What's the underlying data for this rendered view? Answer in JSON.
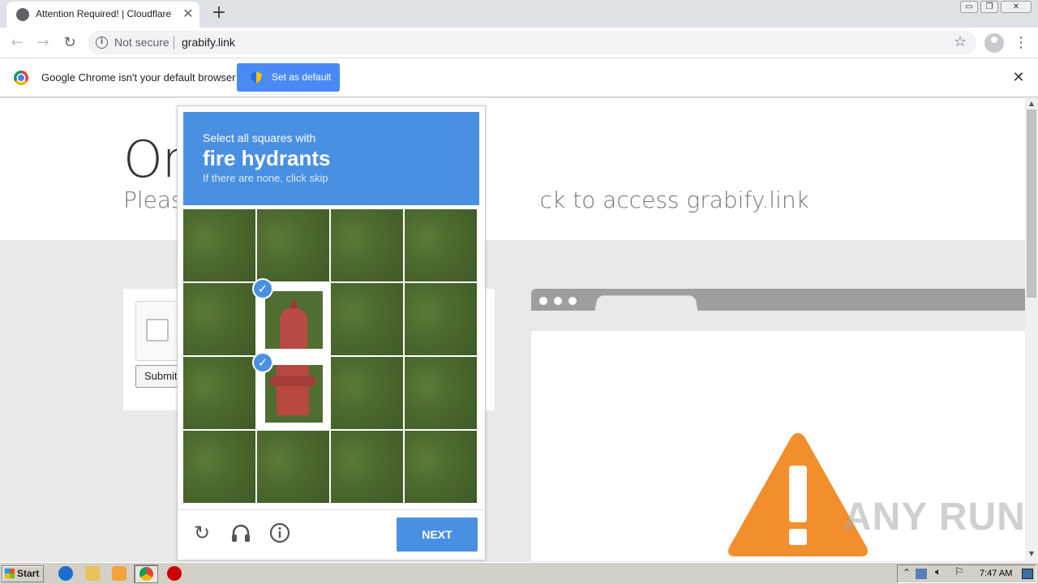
{
  "browser": {
    "tab_title": "Attention Required! | Cloudflare",
    "tab_close": "✕",
    "new_tab": "+",
    "security_label": "Not secure",
    "url": "grabify.link",
    "info_glyph": "i",
    "star_glyph": "☆",
    "menu_glyph": "⋮",
    "back_glyph": "←",
    "forward_glyph": "→",
    "reload_glyph": "↻",
    "window_buttons": [
      "▭",
      "❐",
      "✕"
    ]
  },
  "infobar": {
    "message": "Google Chrome isn't your default browser",
    "set_default_label": "Set as default",
    "close_glyph": "✕"
  },
  "page": {
    "heading_visible": "On",
    "subheading_left": "Pleas",
    "subheading_right": "ck to access grabify.link",
    "submit_label": "Submit"
  },
  "captcha": {
    "instruction": "Select all squares with",
    "target": "fire hydrants",
    "hint": "If there are none, click skip",
    "next_label": "NEXT",
    "reload_icon": "reload-icon",
    "audio_icon": "headphones-icon",
    "info_icon": "info-icon",
    "selected_tiles": [
      5,
      9
    ],
    "colors": {
      "accent": "#4a90e2"
    }
  },
  "watermark": "ANY RUN",
  "taskbar": {
    "start_label": "Start",
    "clock": "7:47 AM"
  },
  "colors": {
    "warning": "#f28e2b",
    "tab_strip": "#dee1e6",
    "set_default_button": "#4a8af4"
  }
}
